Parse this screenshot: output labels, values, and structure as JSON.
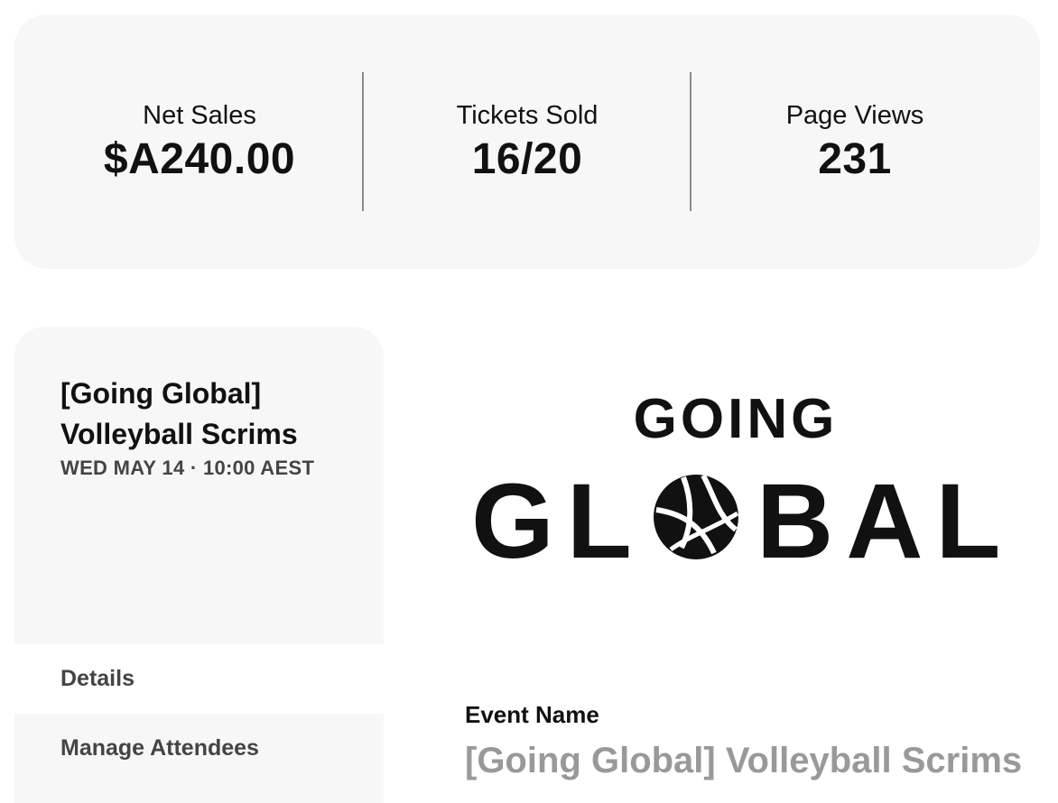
{
  "stats": {
    "net_sales": {
      "label": "Net Sales",
      "value": "$A240.00"
    },
    "tickets_sold": {
      "label": "Tickets Sold",
      "value": "16/20"
    },
    "page_views": {
      "label": "Page Views",
      "value": "231"
    }
  },
  "event": {
    "title": "[Going Global] Volleyball Scrims",
    "date": "WED MAY 14 · 10:00 AEST"
  },
  "nav": {
    "items": [
      {
        "label": "Details"
      },
      {
        "label": "Manage Attendees"
      }
    ]
  },
  "logo": {
    "line1": "GOING",
    "line2": "GL",
    "line3": "BAL",
    "ball_icon": "volleyball-icon"
  },
  "form": {
    "event_name_label": "Event Name",
    "event_name_value": "[Going Global] Volleyball Scrims"
  },
  "colors": {
    "card_bg": "#f7f7f7",
    "divider": "#8a8a8a",
    "muted_text": "#999999"
  }
}
